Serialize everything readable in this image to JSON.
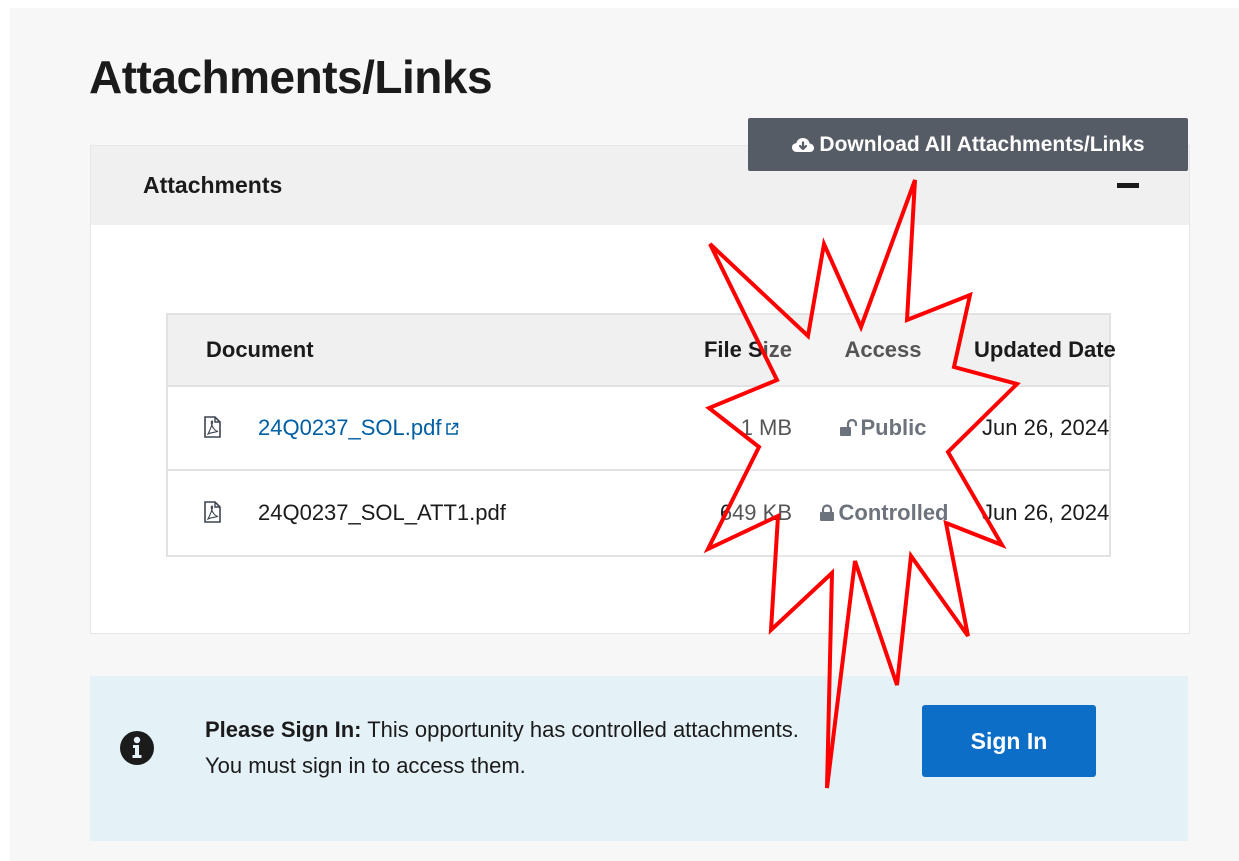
{
  "page": {
    "title": "Attachments/Links"
  },
  "toolbar": {
    "download_all_label": "Download All Attachments/Links",
    "download_icon": "cloud-download-icon"
  },
  "accordion": {
    "title": "Attachments",
    "toggle_icon": "minus-icon"
  },
  "table": {
    "columns": [
      "Document",
      "File Size",
      "Access",
      "Updated Date"
    ],
    "rows": [
      {
        "document": "24Q0237_SOL.pdf",
        "is_link": true,
        "file_size": "1 MB",
        "access": "Public",
        "access_icon": "unlock-icon",
        "updated_date": "Jun 26, 2024"
      },
      {
        "document": "24Q0237_SOL_ATT1.pdf",
        "is_link": false,
        "file_size": "649 KB",
        "access": "Controlled",
        "access_icon": "lock-icon",
        "updated_date": "Jun 26, 2024"
      }
    ]
  },
  "alert": {
    "icon": "info-icon",
    "heading": "Please Sign In:",
    "line1": " This opportunity has controlled attachments.",
    "line2": "You must sign in to access them."
  },
  "signin": {
    "label": "Sign In"
  },
  "colors": {
    "link": "#005ea2",
    "download_button": "#565c65",
    "signin_button": "#0c6ec7",
    "alert_background": "#e4f1f7",
    "callout_stroke": "#ff0000"
  }
}
